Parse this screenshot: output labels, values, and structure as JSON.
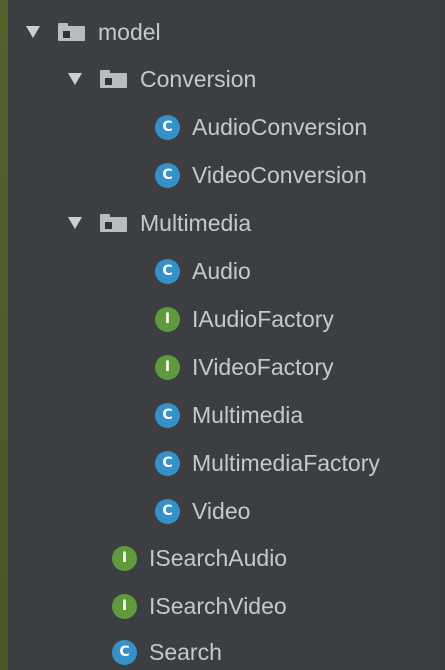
{
  "tree": {
    "model": {
      "label": "model",
      "expanded": true,
      "icon": "folder-icon"
    },
    "conversion": {
      "label": "Conversion",
      "expanded": true,
      "icon": "folder-icon"
    },
    "audio_conversion": {
      "label": "AudioConversion",
      "kind_badge": "C"
    },
    "video_conversion": {
      "label": "VideoConversion",
      "kind_badge": "C"
    },
    "multimedia_folder": {
      "label": "Multimedia",
      "expanded": true,
      "icon": "folder-icon"
    },
    "audio": {
      "label": "Audio",
      "kind_badge": "C"
    },
    "iaudio_factory": {
      "label": "IAudioFactory",
      "kind_badge": "I"
    },
    "ivideo_factory": {
      "label": "IVideoFactory",
      "kind_badge": "I"
    },
    "multimedia": {
      "label": "Multimedia",
      "kind_badge": "C"
    },
    "multimedia_factory": {
      "label": "MultimediaFactory",
      "kind_badge": "C"
    },
    "video": {
      "label": "Video",
      "kind_badge": "C"
    },
    "isearch_audio": {
      "label": "ISearchAudio",
      "kind_badge": "I"
    },
    "isearch_video": {
      "label": "ISearchVideo",
      "kind_badge": "I"
    },
    "search": {
      "label": "Search",
      "kind_badge": "C"
    }
  },
  "colors": {
    "panel_background": "#3c3f41",
    "class_badge": "#3591c7",
    "interface_badge": "#5f9b3d",
    "text": "#c8c8c8"
  }
}
